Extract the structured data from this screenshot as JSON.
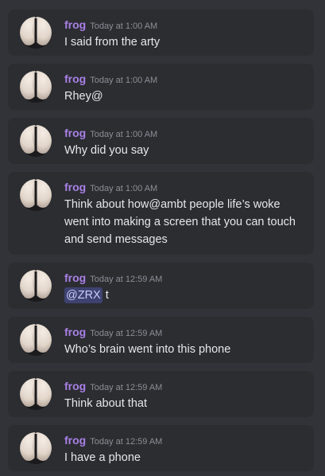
{
  "channel": {
    "messages": [
      {
        "author": "frog",
        "timestamp": "Today at 1:00 AM",
        "text": "I said from the arty"
      },
      {
        "author": "frog",
        "timestamp": "Today at 1:00 AM",
        "text": "Rhey@"
      },
      {
        "author": "frog",
        "timestamp": "Today at 1:00 AM",
        "text": "Why did you say"
      },
      {
        "author": "frog",
        "timestamp": "Today at 1:00 AM",
        "text": "Think about how@ambt people life’s woke went into making a screen that you can touch and send messages"
      },
      {
        "author": "frog",
        "timestamp": "Today at 12:59 AM",
        "mention": "@ZRX",
        "text": " t"
      },
      {
        "author": "frog",
        "timestamp": "Today at 12:59 AM",
        "text": "Who’s brain went into this phone"
      },
      {
        "author": "frog",
        "timestamp": "Today at 12:59 AM",
        "text": "Think about that"
      },
      {
        "author": "frog",
        "timestamp": "Today at 12:59 AM",
        "text": "I have a phone"
      }
    ]
  },
  "colors": {
    "background": "#313338",
    "message_bg": "#2b2d31",
    "username": "#a980e6",
    "timestamp": "#8b8e95",
    "text": "#e6e7e9",
    "mention_bg": "#3e4270"
  }
}
